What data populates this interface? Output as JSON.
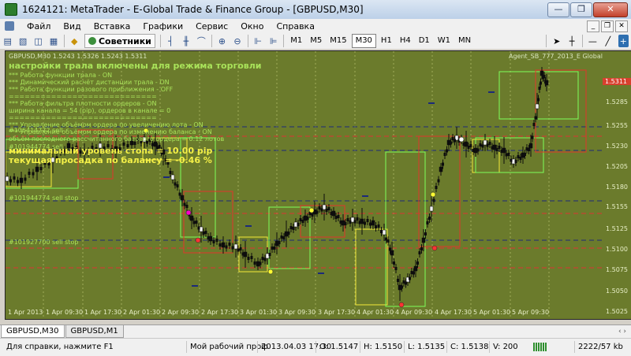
{
  "window": {
    "title": "1624121: MetaTrader - E-Global Trade & Finance Group - [GBPUSD,M30]",
    "minimize": "—",
    "maximize": "❐",
    "close": "✕"
  },
  "menu": {
    "items": [
      "Файл",
      "Вид",
      "Вставка",
      "Графики",
      "Сервис",
      "Окно",
      "Справка"
    ],
    "mdi": [
      "_",
      "❐",
      "✕"
    ]
  },
  "toolbar": {
    "experts_label": "Советники",
    "timeframes": [
      "M1",
      "M5",
      "M15",
      "M30",
      "H1",
      "H4",
      "D1",
      "W1",
      "MN"
    ],
    "active_timeframe": "M30"
  },
  "chart": {
    "symbol_line": "GBPUSD,M30  1.5243 1.5326 1.5243 1.5311",
    "trail_header": "настройки трала включены для режима  торговли",
    "settings_lines": [
      "*** Работа функции трала -   ON",
      "*** Динамический расчёт дистанции трала -   ON",
      "*** Работа функции разового приближения -   OFF",
      "============================",
      "*** Работа фильтра плотности ордеров -   ON",
      "ширина канала = 54 (pip), ордеров в канале =  0",
      "============================",
      "*** Управление объёмом ордера по увеличению лота -   ON",
      "*** Управление объёмом ордера по изменению баланса -   ON",
      "объём последнего рассчитанного базового ордера = 0.12 лотов"
    ],
    "yellow_line_1": "минимальный уровень стопа = 10.00 pip",
    "yellow_line_2": "текущая просадка по балансу = -0.46 %",
    "agent_label": "Agent_SB_777_2013_E Global ☺",
    "order_labels": [
      "#106414772 sell",
      "#101944774 sell",
      "#101944774 sell stop",
      "#101927700 sell stop"
    ],
    "current_price": "1.5311",
    "price_labels": [
      "1.5285",
      "1.5255",
      "1.5230",
      "1.5205",
      "1.5180",
      "1.5155",
      "1.5125",
      "1.5100",
      "1.5075",
      "1.5050",
      "1.5025"
    ],
    "time_labels": [
      "1 Apr 2013",
      "1 Apr 09:30",
      "1 Apr 17:30",
      "2 Apr 01:30",
      "2 Apr 09:30",
      "2 Apr 17:30",
      "3 Apr 01:30",
      "3 Apr 09:30",
      "3 Apr 17:30",
      "4 Apr 01:30",
      "4 Apr 09:30",
      "4 Apr 17:30",
      "5 Apr 01:30",
      "5 Apr 09:30"
    ],
    "colors": {
      "background": "#6b7b2c",
      "candle": "#0d0d0d",
      "box_green": "#7dff5a",
      "box_red": "#e0352b",
      "box_yellow": "#f3ea3a",
      "grid": "#c8cf7a",
      "level_dash": "#1c2a7a"
    }
  },
  "tabs": {
    "items": [
      "GBPUSD,M30",
      "GBPUSD,M1"
    ],
    "arrows": "‹ ›"
  },
  "status": {
    "help": "Для справки, нажмите F1",
    "profile": "Мой рабочий проф",
    "datetime": "2013.04.03 17:30",
    "open": "O: 1.5147",
    "high": "H: 1.5150",
    "low": "L: 1.5135",
    "close": "C: 1.5138",
    "volume": "V: 200",
    "traffic": "2222/57 kb"
  }
}
